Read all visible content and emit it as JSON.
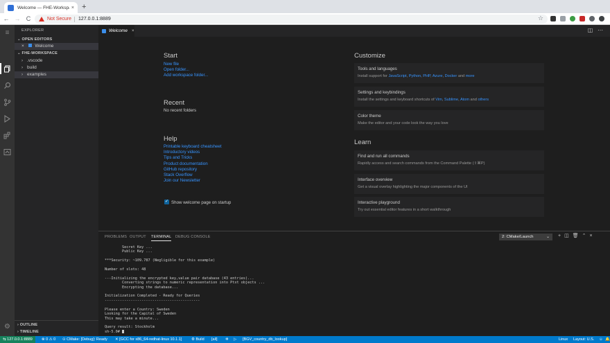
{
  "browser": {
    "tab_title": "Welcome — FHE-Workspace -",
    "tab_close": "×",
    "new_tab": "+",
    "back": "←",
    "forward": "→",
    "reload": "C",
    "security_label": "Not Secure",
    "url": "127.0.0.1:8889",
    "bookmark": "☆"
  },
  "activity": {
    "icons": [
      "menu-icon",
      "files-icon",
      "search-icon",
      "source-control-icon",
      "run-debug-icon",
      "extensions-icon",
      "remote-explorer-icon",
      "settings-gear-icon"
    ]
  },
  "sidebar": {
    "title": "EXPLORER",
    "open_editors_header": "OPEN EDITORS",
    "open_editor_close": "×",
    "open_editor_label": "Welcome",
    "workspace_header": "FHE-WORKSPACE",
    "folders": [
      ".vscode",
      "build",
      "examples"
    ],
    "outline_header": "OUTLINE",
    "timeline_header": "TIMELINE"
  },
  "editor": {
    "tab_label": "Welcome",
    "tab_close": "×"
  },
  "welcome": {
    "start_heading": "Start",
    "start_links": [
      "New file",
      "Open folder...",
      "Add workspace folder..."
    ],
    "recent_heading": "Recent",
    "recent_empty": "No recent folders",
    "help_heading": "Help",
    "help_links": [
      "Printable keyboard cheatsheet",
      "Introductory videos",
      "Tips and Tricks",
      "Product documentation",
      "GitHub repository",
      "Stack Overflow",
      "Join our Newsletter"
    ],
    "show_on_startup": "Show welcome page on startup",
    "customize_heading": "Customize",
    "learn_heading": "Learn",
    "tools_title": "Tools and languages",
    "tools_prefix": "Install support for ",
    "tools_links": [
      "JavaScript",
      "Python",
      "PHP",
      "Azure",
      "Docker"
    ],
    "tools_and": " and ",
    "tools_more": "more",
    "settings_title": "Settings and keybindings",
    "settings_prefix": "Install the settings and keyboard shortcuts of ",
    "settings_links": [
      "Vim",
      "Sublime",
      "Atom"
    ],
    "settings_and": " and ",
    "settings_others": "others",
    "theme_title": "Color theme",
    "theme_desc": "Make the editor and your code look the way you love",
    "find_title": "Find and run all commands",
    "find_desc": "Rapidly access and search commands from the Command Palette (⇧⌘P)",
    "interface_title": "Interface overview",
    "interface_desc": "Get a visual overlay highlighting the major components of the UI",
    "playground_title": "Interactive playground",
    "playground_desc": "Try out essential editor features in a short walkthrough"
  },
  "panel": {
    "tabs": [
      "PROBLEMS",
      "OUTPUT",
      "TERMINAL",
      "DEBUG CONSOLE"
    ],
    "terminal_select": "2: CMake/Launch",
    "terminal_lines": [
      "        Secret Key ...",
      "        Public Key ...",
      "",
      "***Security: ~109.787 (Negligible for this example)",
      "",
      "Number of slots: 48",
      "",
      "---Initializing the encrypted key,value pair database (43 entries)...",
      "        Converting strings to numeric representation into Ptxt objects ...",
      "        Encrypting the database...",
      "",
      "Initialization Completed - Ready for Queries",
      "--------------------------------------------",
      "",
      "Please enter a Country: Sweden",
      "Looking for the Capital of Sweden",
      "This may take a minute...",
      "",
      "Query result: Stockholm",
      "sh-5.0# "
    ]
  },
  "status": {
    "remote": "127.0.0.1:8889",
    "problems": "⊗ 0 ⚠ 0",
    "cmake": "⊙ CMake: [Debug]: Ready",
    "kit": "✕ [GCC for x86_64-redhat-linux 10.1.1]",
    "build": "⚙ Build",
    "target": "[all]",
    "launch_target": "[BGV_country_db_lookup]",
    "os": "Linux",
    "layout": "Layout: U.S."
  }
}
